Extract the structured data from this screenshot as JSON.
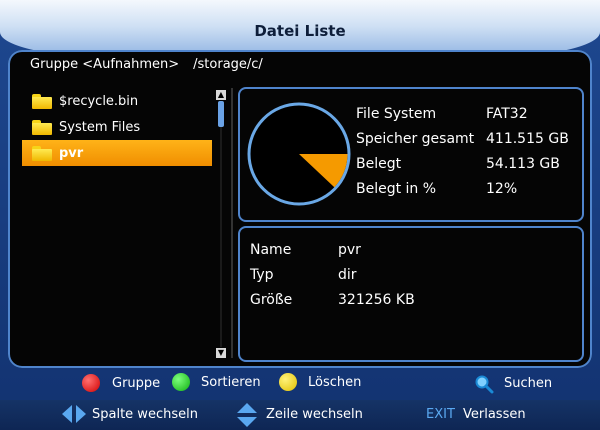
{
  "window": {
    "title": "Datei Liste"
  },
  "path": {
    "group": "Gruppe <Aufnahmen>",
    "dir": "/storage/c/"
  },
  "files": [
    {
      "name": "$recycle.bin",
      "selected": false
    },
    {
      "name": "System Files",
      "selected": false
    },
    {
      "name": "pvr",
      "selected": true
    }
  ],
  "storage": {
    "fs_label": "File System",
    "fs_value": "FAT32",
    "total_label": "Speicher gesamt",
    "total_value": "411.515 GB",
    "used_label": "Belegt",
    "used_value": "54.113 GB",
    "pct_label": "Belegt in %",
    "pct_value": "12%",
    "used_fraction": 0.12
  },
  "details": {
    "name_label": "Name",
    "name_value": "pvr",
    "type_label": "Typ",
    "type_value": "dir",
    "size_label": "Größe",
    "size_value": "321256 KB"
  },
  "colors": {
    "accent": "#f59a00",
    "border": "#4f84cc",
    "red": "#e81010",
    "green": "#19c219",
    "yellow": "#f2dc10"
  },
  "keys": {
    "red": "Gruppe",
    "green": "Sortieren",
    "yellow": "Löschen",
    "search": "Suchen",
    "lr": "Spalte wechseln",
    "ud": "Zeile wechseln",
    "exit_key": "EXIT",
    "exit": "Verlassen"
  }
}
